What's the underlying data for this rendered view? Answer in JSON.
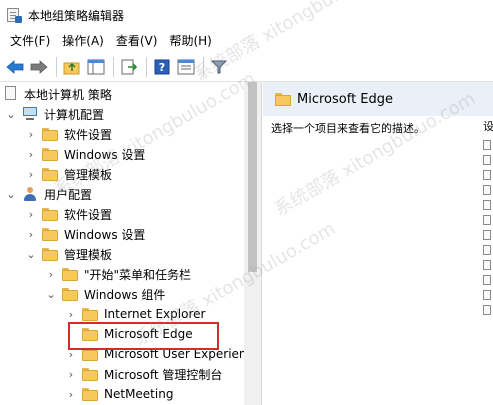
{
  "window": {
    "title": "本地组策略编辑器"
  },
  "menu": [
    "文件(F)",
    "操作(A)",
    "查看(V)",
    "帮助(H)"
  ],
  "toolbar": {
    "buttons": [
      "back-arrow-icon",
      "forward-arrow-icon",
      "up-folder-icon",
      "show-hide-tree-icon",
      "export-list-icon",
      "help-icon",
      "properties-icon",
      "filter-icon"
    ]
  },
  "tree": {
    "root": "本地计算机 策略",
    "computer_config": "计算机配置",
    "software_settings_1": "软件设置",
    "windows_settings_1": "Windows 设置",
    "admin_templates_1": "管理模板",
    "user_config": "用户配置",
    "software_settings_2": "软件设置",
    "windows_settings_2": "Windows 设置",
    "admin_templates_2": "管理模板",
    "start_menu": "\"开始\"菜单和任务栏",
    "windows_components": "Windows 组件",
    "internet_explorer": "Internet Explorer",
    "microsoft_edge": "Microsoft Edge",
    "microsoft_user_experience": "Microsoft User Experien",
    "microsoft_mgmt_console": "Microsoft 管理控制台",
    "netmeeting": "NetMeeting"
  },
  "right_pane": {
    "header": "Microsoft Edge",
    "description": "选择一个项目来查看它的描述。",
    "list_header_partial": "设"
  },
  "watermark": "系统部落 xitongbuluo.com"
}
